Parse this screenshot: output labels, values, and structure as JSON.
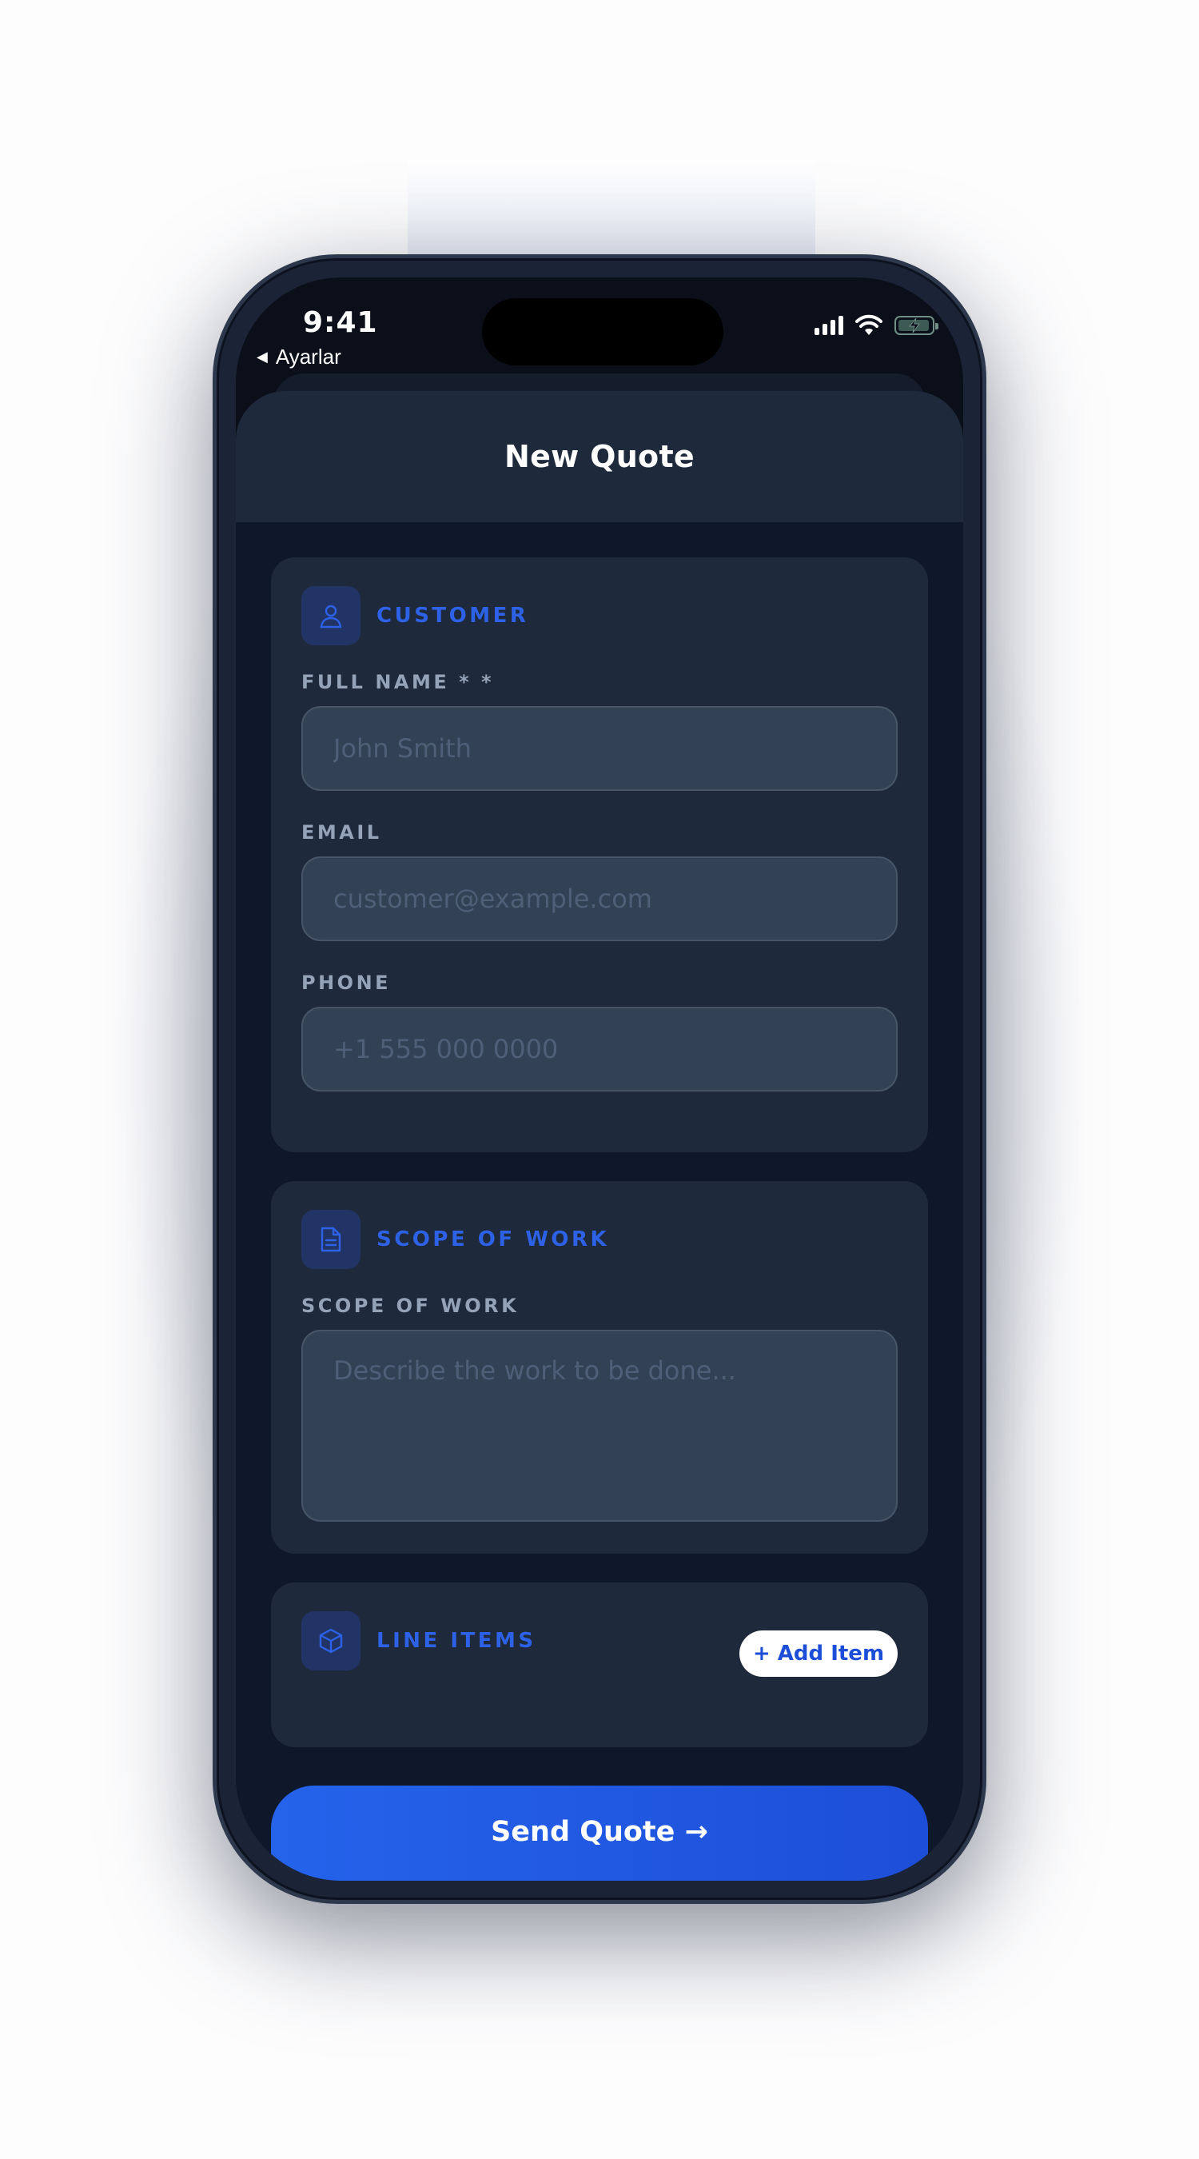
{
  "status_bar": {
    "time": "9:41",
    "back_label": "Ayarlar",
    "back_icon": "triangle-left-icon",
    "icons": [
      "cellular-signal-icon",
      "wifi-icon",
      "battery-charging-icon"
    ]
  },
  "header": {
    "title": "New Quote"
  },
  "customer": {
    "section_title": "CUSTOMER",
    "icon": "user-icon",
    "fields": [
      {
        "label": "FULL NAME * *",
        "placeholder": "John Smith",
        "value": ""
      },
      {
        "label": "EMAIL",
        "placeholder": "customer@example.com",
        "value": ""
      },
      {
        "label": "PHONE",
        "placeholder": "+1 555 000 0000",
        "value": ""
      }
    ]
  },
  "scope": {
    "section_title": "SCOPE OF WORK",
    "icon": "document-icon",
    "field_label": "SCOPE OF WORK",
    "placeholder": "Describe the work to be done...",
    "value": ""
  },
  "line_items": {
    "section_title": "LINE ITEMS",
    "icon": "box-icon",
    "add_label": "+ Add Item"
  },
  "send_button": {
    "label": "Send Quote →"
  },
  "colors": {
    "accent": "#2563eb",
    "card": "#1e293b",
    "sheet": "#0f172a",
    "input": "#334155"
  }
}
